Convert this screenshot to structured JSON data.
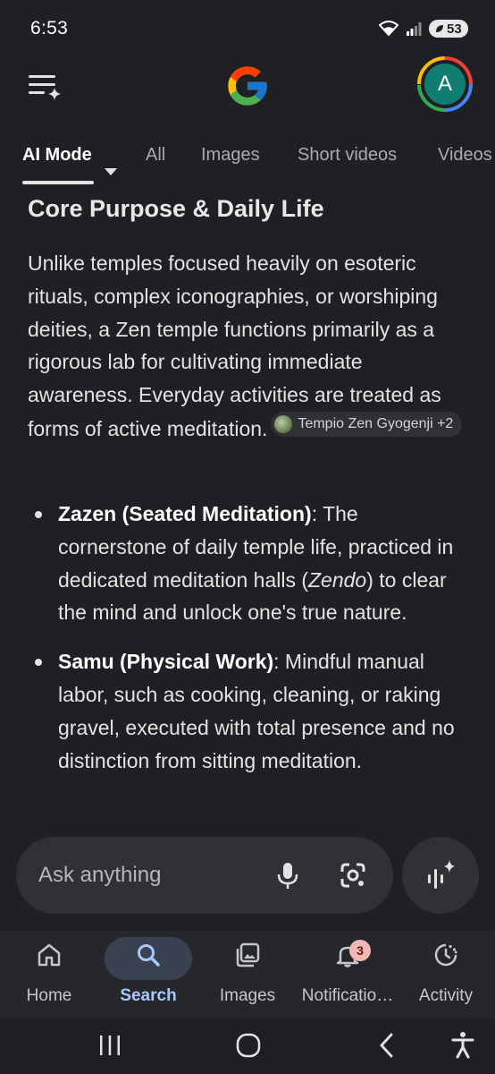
{
  "status_bar": {
    "time": "6:53",
    "battery": "53",
    "icons": [
      "wifi-icon",
      "signal-icon",
      "battery-saver-icon"
    ]
  },
  "header": {
    "logo": "google-g-logo",
    "avatar_letter": "A",
    "colors": {
      "avatar_bg": "#0f7d6f",
      "background": "#1f2024"
    }
  },
  "tabs": [
    {
      "label": "AI Mode",
      "active": true
    },
    {
      "label": "All"
    },
    {
      "label": "Images"
    },
    {
      "label": "Short videos"
    },
    {
      "label": "Videos"
    }
  ],
  "article": {
    "title": "Core Purpose & Daily Life",
    "paragraph": "Unlike temples focused heavily on esoteric rituals, complex iconographies, or worshiping deities, a Zen temple functions primarily as a rigorous lab for cultivating immediate awareness. Everyday activities are treated as forms of active meditation.",
    "citation_chip": "Tempio Zen Gyogenji +2",
    "bullets": [
      {
        "bold": "Zazen (Seated Meditation)",
        "text_before": ": The cornerstone of daily temple life, practiced in dedicated meditation halls (",
        "italic": "Zendo",
        "text_after": ") to clear the mind and unlock one's true nature."
      },
      {
        "bold": "Samu (Physical Work)",
        "text": ": Mindful manual labor, such as cooking, cleaning, or raking gravel, executed with total presence and no distinction from sitting meditation."
      }
    ]
  },
  "ask_bar": {
    "placeholder": "Ask anything"
  },
  "bottom_nav": [
    {
      "label": "Home",
      "icon": "home-icon"
    },
    {
      "label": "Search",
      "icon": "search-icon",
      "active": true
    },
    {
      "label": "Images",
      "icon": "images-icon"
    },
    {
      "label": "Notificatio…",
      "icon": "bell-icon",
      "badge": "3"
    },
    {
      "label": "Activity",
      "icon": "activity-icon"
    }
  ]
}
